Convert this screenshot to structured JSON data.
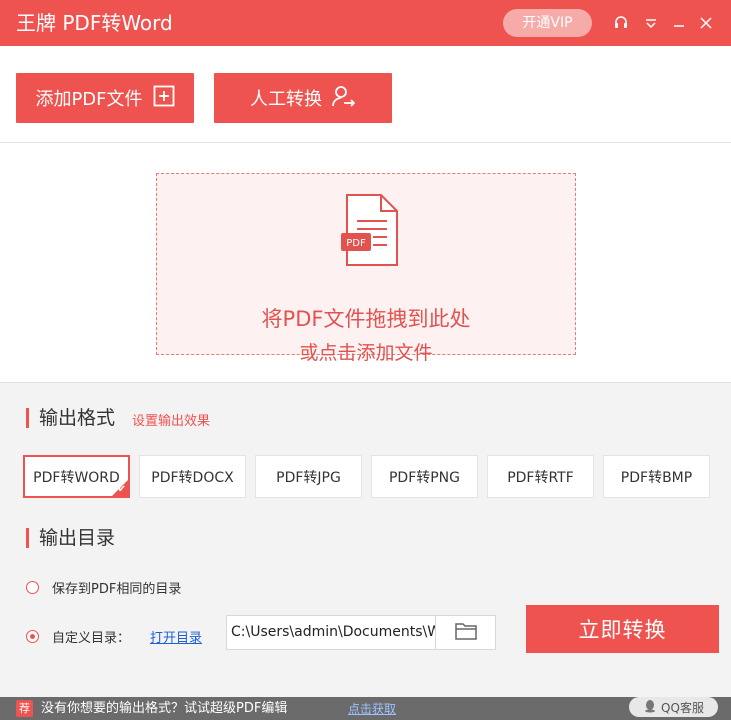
{
  "titlebar": {
    "title": "王牌 PDF转Word",
    "vip_label": "开通VIP"
  },
  "toolbar": {
    "add_label": "添加PDF文件",
    "manual_label": "人工转换"
  },
  "dropzone": {
    "file_badge": "PDF",
    "line1": "将PDF文件拖拽到此处",
    "line2": "或点击添加文件"
  },
  "output_format": {
    "title": "输出格式",
    "settings_link": "设置输出效果",
    "options": [
      "PDF转WORD",
      "PDF转DOCX",
      "PDF转JPG",
      "PDF转PNG",
      "PDF转RTF",
      "PDF转BMP"
    ],
    "selected": "PDF转WORD"
  },
  "output_dir": {
    "title": "输出目录",
    "option_same": "保存到PDF相同的目录",
    "option_custom": "自定义目录：",
    "open_dir": "打开目录",
    "path": "C:\\Users\\admin\\Documents\\W",
    "selected": "custom"
  },
  "convert_label": "立即转换",
  "bottombar": {
    "badge": "荐",
    "promo": "没有你想要的输出格式？试试超级PDF编辑",
    "link": "点击获取",
    "qq": "QQ客服"
  },
  "colors": {
    "accent": "#ee5350",
    "link": "#1e5fd6"
  }
}
